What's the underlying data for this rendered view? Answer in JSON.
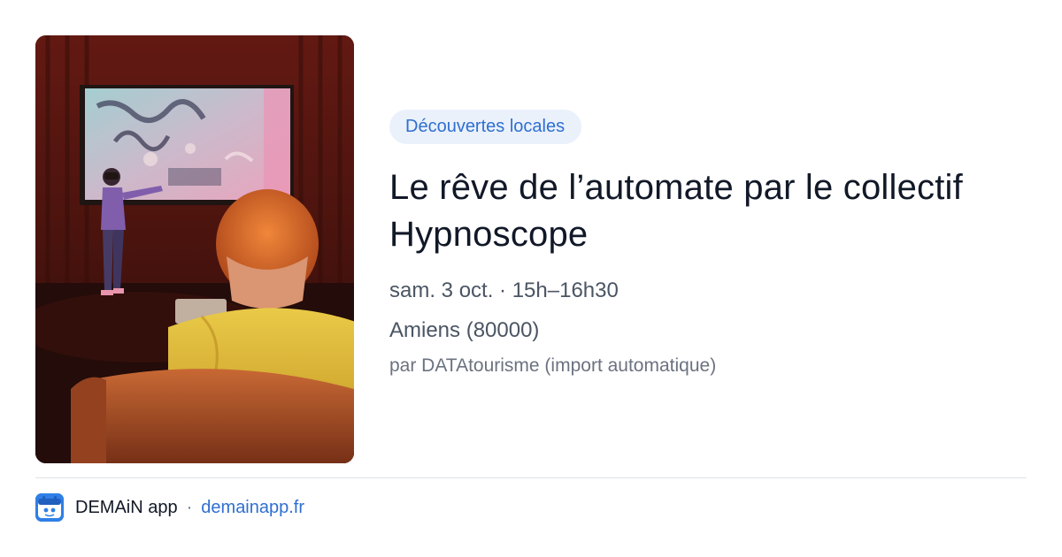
{
  "event": {
    "category": "Découvertes locales",
    "title": "Le rêve de l’automate par le collectif Hypnoscope",
    "datetime": "sam. 3 oct. · 15h–16h30",
    "location": "Amiens (80000)",
    "source": "par DATAtourisme (import automatique)",
    "image": "photo-vr-performance-hypnoscope"
  },
  "footer": {
    "app_icon": "demain-app-logo-icon",
    "app_name": "DEMAiN app",
    "separator": "·",
    "site": "demainapp.fr"
  },
  "colors": {
    "accent": "#2f6fd0",
    "tag_bg": "#eaf1fb",
    "title": "#111827",
    "muted": "#6b7280"
  }
}
